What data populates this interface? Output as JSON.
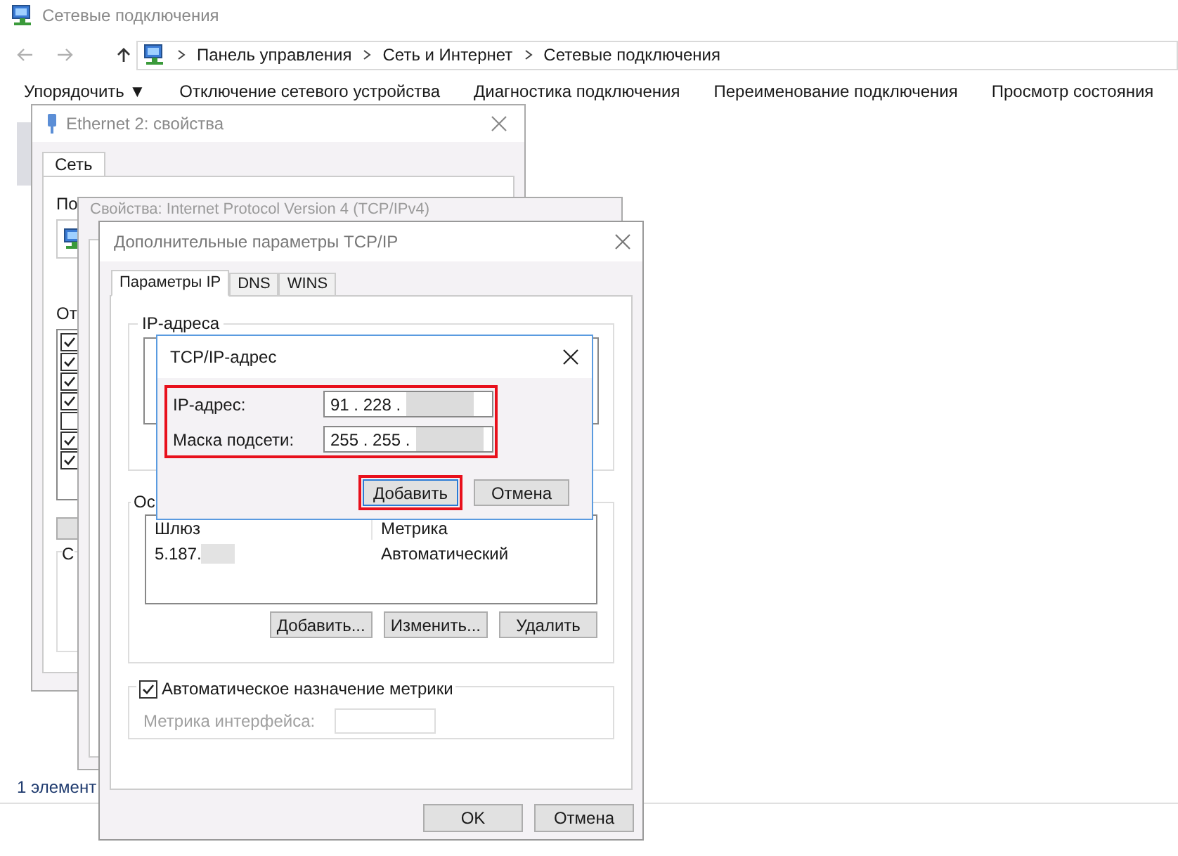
{
  "explorer": {
    "title": "Сетевые подключения",
    "breadcrumbs": [
      "Панель управления",
      "Сеть и Интернет",
      "Сетевые подключения"
    ],
    "toolbar": [
      "Упорядочить ▼",
      "Отключение сетевого устройства",
      "Диагностика подключения",
      "Переименование подключения",
      "Просмотр состояния"
    ],
    "status": "1 элемент"
  },
  "ethernet_dialog": {
    "title": "Ethernet 2: свойства",
    "tabs": [
      {
        "label": "Сеть",
        "selected": true
      }
    ],
    "connect_label": "По",
    "components_label": "От",
    "group_label": "С",
    "components": [
      {
        "checked": true
      },
      {
        "checked": true
      },
      {
        "checked": true
      },
      {
        "checked": true
      },
      {
        "checked": false
      },
      {
        "checked": true
      },
      {
        "checked": true
      }
    ]
  },
  "ipv4_dialog": {
    "title": "Свойства: Internet Protocol Version 4 (TCP/IPv4)"
  },
  "advanced_dialog": {
    "title": "Дополнительные параметры TCP/IP",
    "tabs": [
      {
        "label": "Параметры IP",
        "selected": true
      },
      {
        "label": "DNS",
        "selected": false
      },
      {
        "label": "WINS",
        "selected": false
      }
    ],
    "ip_group": "IP-адреса",
    "gateway_group": "Ос",
    "gateway_columns": [
      "Шлюз",
      "Метрика"
    ],
    "gateways": [
      {
        "address": "5.187.",
        "metric": "Автоматический"
      }
    ],
    "gateway_buttons": [
      "Добавить...",
      "Изменить...",
      "Удалить"
    ],
    "auto_metric": {
      "label": "Автоматическое назначение метрики",
      "checked": true
    },
    "metric": {
      "label": "Метрика интерфейса:",
      "disabled": true
    },
    "buttons": [
      "OK",
      "Отмена"
    ]
  },
  "address_dialog": {
    "title": "TCP/IP-адрес",
    "fields": [
      {
        "label": "IP-адрес:",
        "value": "91 . 228 ."
      },
      {
        "label": "Маска подсети:",
        "value": "255 . 255 ."
      }
    ],
    "buttons": [
      {
        "label": "Добавить",
        "highlighted": true
      },
      {
        "label": "Отмена",
        "highlighted": false
      }
    ]
  }
}
